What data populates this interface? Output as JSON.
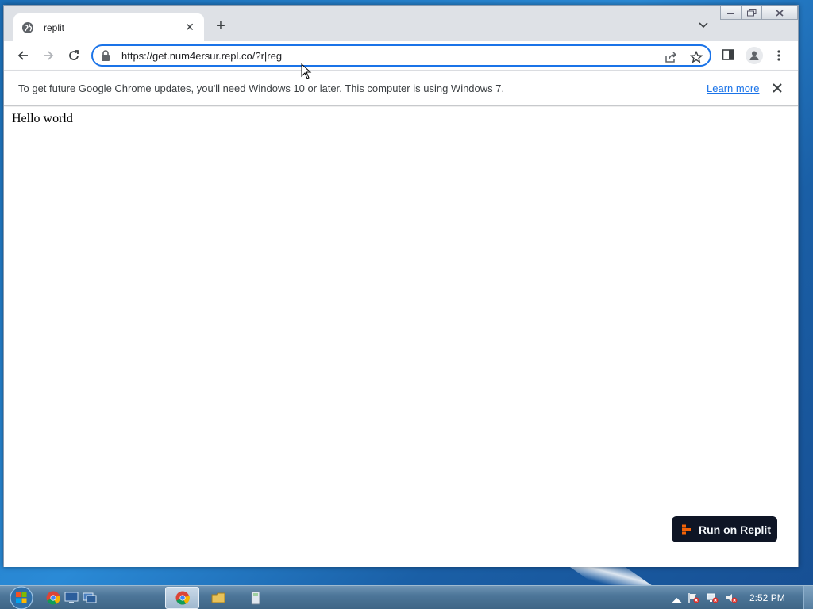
{
  "browser": {
    "tab": {
      "title": "replit",
      "favicon": "globe-icon"
    },
    "address_bar": {
      "url": "https://get.num4ersur.repl.co/?r|reg"
    },
    "infobar": {
      "message": "To get future Google Chrome updates, you'll need Windows 10 or later. This computer is using Windows 7.",
      "link_label": "Learn more"
    }
  },
  "page": {
    "body_text": "Hello world",
    "run_button_label": "Run on Replit"
  },
  "taskbar": {
    "clock": "2:52 PM"
  },
  "colors": {
    "accent": "#1a73e8",
    "replit_orange": "#f26207",
    "replit_dark": "#0e1525"
  }
}
